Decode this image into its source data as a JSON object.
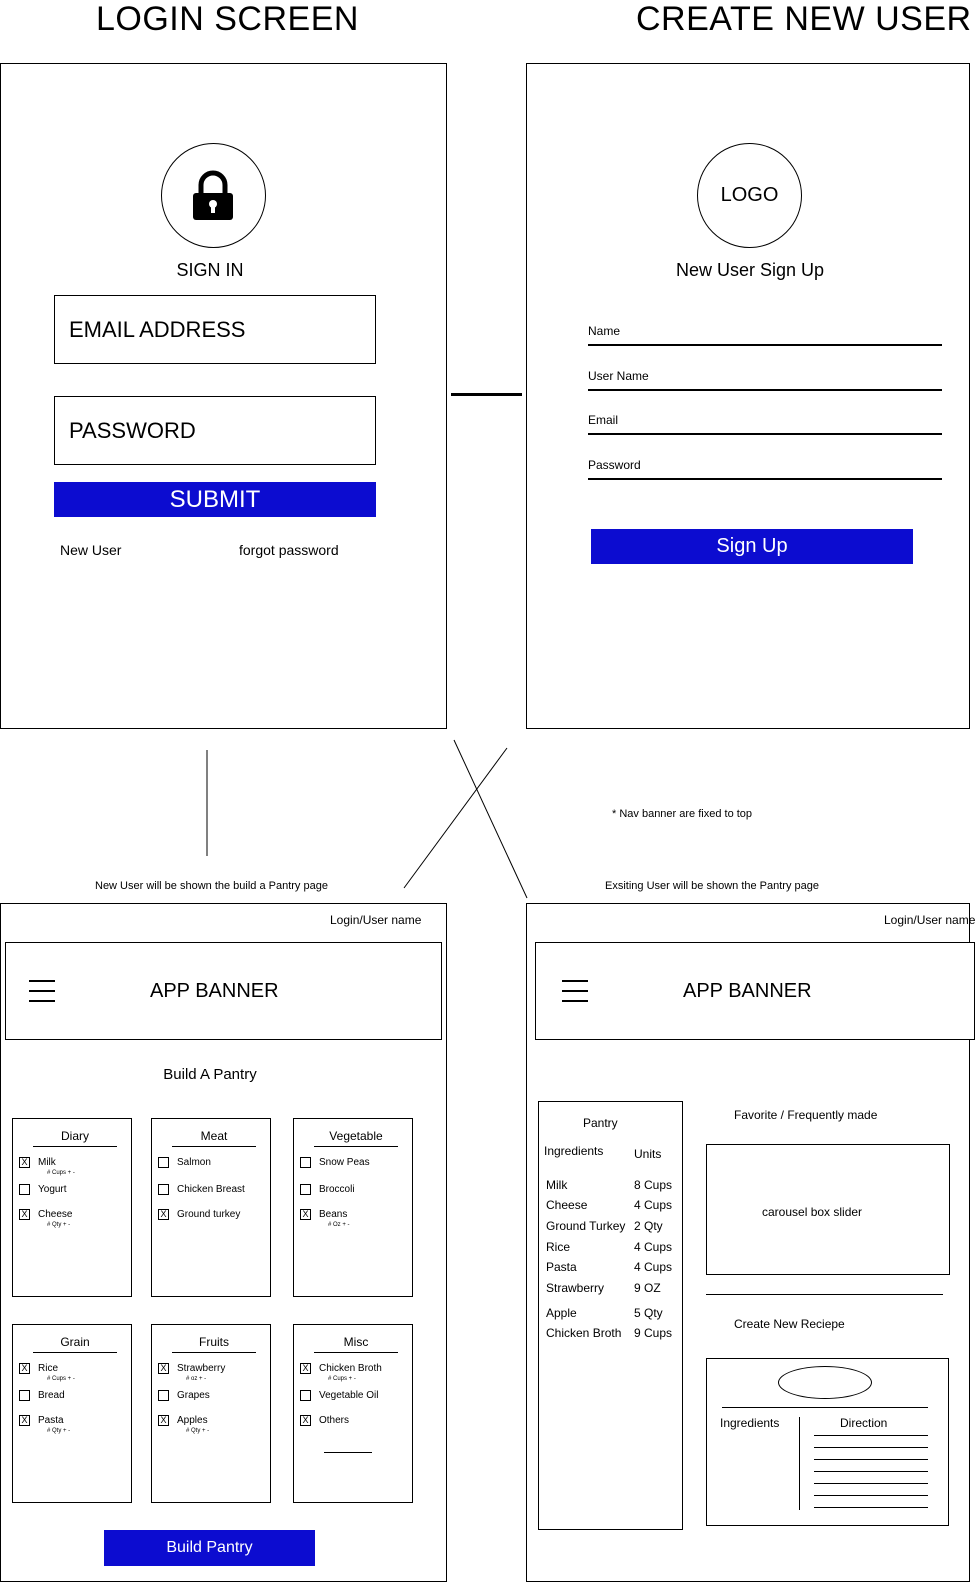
{
  "login": {
    "title": "LOGIN SCREEN",
    "sign_in": "SIGN IN",
    "email_placeholder": "EMAIL ADDRESS",
    "password_placeholder": "PASSWORD",
    "submit": "SUBMIT",
    "new_user": "New User",
    "forgot_password": "forgot password"
  },
  "create_user": {
    "title": "CREATE NEW USER",
    "logo": "LOGO",
    "heading": "New User Sign Up",
    "fields": [
      "Name",
      "User Name",
      "Email",
      "Password"
    ],
    "sign_up": "Sign Up"
  },
  "notes": {
    "nav_fixed": "* Nav banner are fixed to top",
    "new_user_note": "New User will be shown the build a Pantry page",
    "existing_user_note": "Exsiting User will be shown the Pantry page"
  },
  "build_pantry": {
    "login_user": "Login/User name",
    "banner": "APP BANNER",
    "heading": "Build A Pantry",
    "categories": [
      {
        "title": "Diary",
        "items": [
          {
            "label": "Milk",
            "checked": true,
            "sub": "# Cups + -"
          },
          {
            "label": "Yogurt",
            "checked": false,
            "sub": ""
          },
          {
            "label": "Cheese",
            "checked": true,
            "sub": "# Qty + -"
          }
        ]
      },
      {
        "title": "Meat",
        "items": [
          {
            "label": "Salmon",
            "checked": false,
            "sub": ""
          },
          {
            "label": "Chicken Breast",
            "checked": false,
            "sub": ""
          },
          {
            "label": "Ground turkey",
            "checked": true,
            "sub": ""
          }
        ]
      },
      {
        "title": "Vegetable",
        "items": [
          {
            "label": "Snow Peas",
            "checked": false,
            "sub": ""
          },
          {
            "label": "Broccoli",
            "checked": false,
            "sub": ""
          },
          {
            "label": "Beans",
            "checked": true,
            "sub": "# Oz + -"
          }
        ]
      },
      {
        "title": "Grain",
        "items": [
          {
            "label": "Rice",
            "checked": true,
            "sub": "# Cups + -"
          },
          {
            "label": "Bread",
            "checked": false,
            "sub": ""
          },
          {
            "label": "Pasta",
            "checked": true,
            "sub": "# Qty + -"
          }
        ]
      },
      {
        "title": "Fruits",
        "items": [
          {
            "label": "Strawberry",
            "checked": true,
            "sub": "# oz + -"
          },
          {
            "label": "Grapes",
            "checked": false,
            "sub": ""
          },
          {
            "label": "Apples",
            "checked": true,
            "sub": "# Qty + -"
          }
        ]
      },
      {
        "title": "Misc",
        "items": [
          {
            "label": "Chicken Broth",
            "checked": true,
            "sub": "# Cups + -"
          },
          {
            "label": "Vegetable Oil",
            "checked": false,
            "sub": ""
          },
          {
            "label": "Others",
            "checked": true,
            "sub": ""
          }
        ]
      }
    ],
    "button": "Build Pantry"
  },
  "pantry": {
    "login_user": "Login/User name",
    "banner": "APP BANNER",
    "panel_title": "Pantry",
    "col_ingredients": "Ingredients",
    "col_units": "Units",
    "rows": [
      {
        "name": "Milk",
        "units": "8 Cups"
      },
      {
        "name": "Cheese",
        "units": "4 Cups"
      },
      {
        "name": "Ground Turkey",
        "units": "2 Qty"
      },
      {
        "name": "Rice",
        "units": "4 Cups"
      },
      {
        "name": "Pasta",
        "units": "4 Cups"
      },
      {
        "name": "Strawberry",
        "units": "9 OZ"
      },
      {
        "name": "Apple",
        "units": "5 Qty"
      },
      {
        "name": "Chicken Broth",
        "units": "9 Cups"
      }
    ],
    "favorites_title": "Favorite / Frequently made",
    "carousel": "carousel box slider",
    "create_recipe": "Create New Reciepe",
    "recipe_ingredients": "Ingredients",
    "recipe_direction": "Direction"
  }
}
